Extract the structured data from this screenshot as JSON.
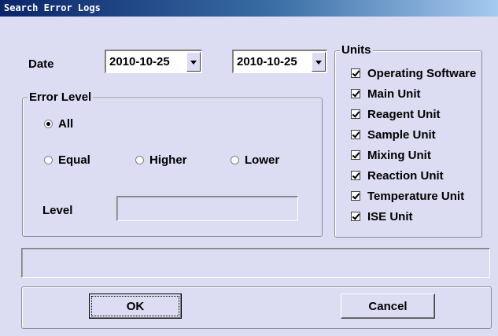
{
  "window": {
    "title": "Search Error Logs"
  },
  "date": {
    "label": "Date",
    "from": "2010-10-25",
    "to": "2010-10-25"
  },
  "error_level": {
    "group_label": "Error Level",
    "options": {
      "all": "All",
      "equal": "Equal",
      "higher": "Higher",
      "lower": "Lower"
    },
    "selected": "All",
    "level_label": "Level",
    "level_value": ""
  },
  "units": {
    "group_label": "Units",
    "items": [
      {
        "label": "Operating Software",
        "checked": true
      },
      {
        "label": "Main Unit",
        "checked": true
      },
      {
        "label": "Reagent Unit",
        "checked": true
      },
      {
        "label": "Sample Unit",
        "checked": true
      },
      {
        "label": "Mixing Unit",
        "checked": true
      },
      {
        "label": "Reaction Unit",
        "checked": true
      },
      {
        "label": "Temperature Unit",
        "checked": true
      },
      {
        "label": "ISE Unit",
        "checked": true
      }
    ]
  },
  "status_text": "",
  "buttons": {
    "ok": "OK",
    "cancel": "Cancel"
  }
}
